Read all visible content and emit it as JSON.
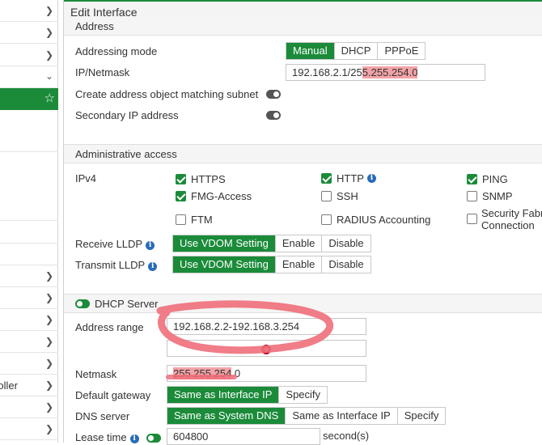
{
  "panel": {
    "title": "Edit Interface"
  },
  "sidebar": {
    "partial_label": "oller"
  },
  "address": {
    "section_title": "Address",
    "mode_label": "Addressing mode",
    "modes": [
      "Manual",
      "DHCP",
      "PPPoE"
    ],
    "active_mode": "Manual",
    "ip_label": "IP/Netmask",
    "ip_value_a": "192.168.2.1/25",
    "ip_value_b": "5.255.254.0",
    "create_object_label": "Create address object matching subnet",
    "secondary_label": "Secondary IP address"
  },
  "admin": {
    "section_title": "Administrative access",
    "ipv4_label": "IPv4",
    "https": "HTTPS",
    "http": "HTTP",
    "ping": "PING",
    "fmg": "FMG-Access",
    "ssh": "SSH",
    "snmp": "SNMP",
    "ftm": "FTM",
    "radius": "RADIUS Accounting",
    "security_fabric_1": "Security Fabr",
    "security_fabric_2": "Connection",
    "receive_lldp_label": "Receive LLDP",
    "transmit_lldp_label": "Transmit LLDP",
    "lldp_options": [
      "Use VDOM Setting",
      "Enable",
      "Disable"
    ]
  },
  "dhcp": {
    "section_title": "DHCP Server",
    "range_label": "Address range",
    "range_value": "192.168.2.2-192.168.3.254",
    "netmask_label": "Netmask",
    "netmask_a": "255.255.254",
    "netmask_b": ".0",
    "gateway_label": "Default gateway",
    "gateway_options": [
      "Same as Interface IP",
      "Specify"
    ],
    "dns_label": "DNS server",
    "dns_options": [
      "Same as System DNS",
      "Same as Interface IP",
      "Specify"
    ],
    "lease_label": "Lease time",
    "lease_value": "604800",
    "lease_unit": "second(s)"
  },
  "colors": {
    "accent": "#1b8b3a",
    "highlight": "#f3a3a8",
    "annotation": "#ee6f7a"
  }
}
